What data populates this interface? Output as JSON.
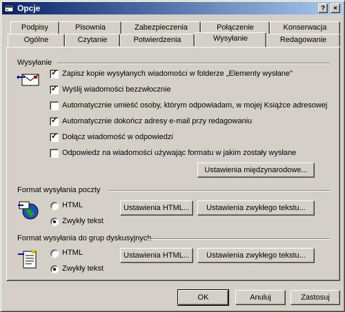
{
  "window": {
    "title": "Opcje",
    "help_glyph": "?",
    "close_glyph": "×"
  },
  "tabs_back": [
    "Podpisy",
    "Pisownia",
    "Zabezpieczenia",
    "Połączenie",
    "Konserwacja"
  ],
  "tabs_front": [
    "Ogólne",
    "Czytanie",
    "Potwierdzenia",
    "Wysyłanie",
    "Redagowanie"
  ],
  "active_tab": "Wysyłanie",
  "sending": {
    "title": "Wysyłanie",
    "options": [
      {
        "label": "Zapisz kopie wysyłanych wiadomości w folderze „Elementy wysłane\"",
        "checked": true
      },
      {
        "label": "Wyślij wiadomości bezzwłocznie",
        "checked": true
      },
      {
        "label": "Automatycznie umieść osoby, którym odpowiadam, w mojej Książce adresowej",
        "checked": false
      },
      {
        "label": "Automatycznie dokończ adresy e-mail przy redagowaniu",
        "checked": true
      },
      {
        "label": "Dołącz wiadomość w odpowiedzi",
        "checked": true
      },
      {
        "label": "Odpowiedz na wiadomości używając formatu w jakim zostały wysłane",
        "checked": false
      }
    ],
    "intl_button": "Ustawienia międzynarodowe..."
  },
  "mail_format": {
    "title": "Format wysyłania poczty",
    "html_label": "HTML",
    "plain_label": "Zwykły tekst",
    "selected": "plain",
    "html_settings_button": "Ustawienia HTML...",
    "plain_settings_button": "Ustawienia zwykłego tekstu..."
  },
  "news_format": {
    "title": "Format wysyłania do grup dyskusyjnych",
    "html_label": "HTML",
    "plain_label": "Zwykły tekst",
    "selected": "plain",
    "html_settings_button": "Ustawienia HTML...",
    "plain_settings_button": "Ustawienia zwykłego tekstu..."
  },
  "footer": {
    "ok": "OK",
    "cancel": "Anuluj",
    "apply": "Zastosuj"
  }
}
